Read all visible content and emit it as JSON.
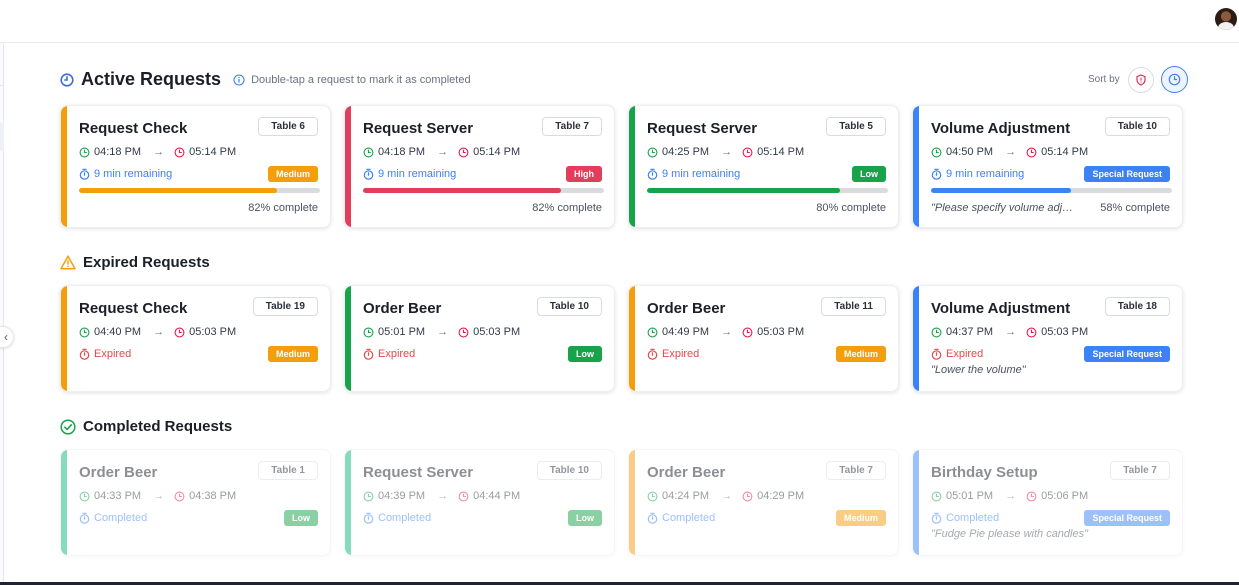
{
  "colors": {
    "orange": "#f59e0b",
    "red": "#e23d5a",
    "green": "#16a34a",
    "teal": "#10b981",
    "blue": "#3b82f6",
    "time_green": "#16a34a",
    "time_red": "#e11d48",
    "link_blue": "#3b82f6",
    "expired_red": "#e34a4a"
  },
  "header": {
    "active_title": "Active Requests",
    "active_hint": "Double-tap a request to mark it as completed",
    "sort_label": "Sort by",
    "expired_title": "Expired Requests",
    "completed_title": "Completed Requests"
  },
  "active": [
    {
      "title": "Request Check",
      "table": "Table 6",
      "start": "04:18 PM",
      "end": "05:14 PM",
      "status": "9 min remaining",
      "priority": "Medium",
      "progress": 82,
      "pct": "82% complete",
      "note": ""
    },
    {
      "title": "Request Server",
      "table": "Table 7",
      "start": "04:18 PM",
      "end": "05:14 PM",
      "status": "9 min remaining",
      "priority": "High",
      "progress": 82,
      "pct": "82% complete",
      "note": ""
    },
    {
      "title": "Request Server",
      "table": "Table 5",
      "start": "04:25 PM",
      "end": "05:14 PM",
      "status": "9 min remaining",
      "priority": "Low",
      "progress": 80,
      "pct": "80% complete",
      "note": ""
    },
    {
      "title": "Volume Adjustment",
      "table": "Table 10",
      "start": "04:50 PM",
      "end": "05:14 PM",
      "status": "9 min remaining",
      "priority": "Special Request",
      "progress": 58,
      "pct": "58% complete",
      "note": "\"Please specify volume adj…"
    }
  ],
  "expired": [
    {
      "title": "Request Check",
      "table": "Table 19",
      "start": "04:40 PM",
      "end": "05:03 PM",
      "status": "Expired",
      "priority": "Medium",
      "note": ""
    },
    {
      "title": "Order Beer",
      "table": "Table 10",
      "start": "05:01 PM",
      "end": "05:03 PM",
      "status": "Expired",
      "priority": "Low",
      "note": ""
    },
    {
      "title": "Order Beer",
      "table": "Table 11",
      "start": "04:49 PM",
      "end": "05:03 PM",
      "status": "Expired",
      "priority": "Medium",
      "note": ""
    },
    {
      "title": "Volume Adjustment",
      "table": "Table 18",
      "start": "04:37 PM",
      "end": "05:03 PM",
      "status": "Expired",
      "priority": "Special Request",
      "note": "\"Lower the volume\""
    }
  ],
  "completed": [
    {
      "title": "Order Beer",
      "table": "Table 1",
      "start": "04:33 PM",
      "end": "04:38 PM",
      "status": "Completed",
      "priority": "Low",
      "note": ""
    },
    {
      "title": "Request Server",
      "table": "Table 10",
      "start": "04:39 PM",
      "end": "04:44 PM",
      "status": "Completed",
      "priority": "Low",
      "note": ""
    },
    {
      "title": "Order Beer",
      "table": "Table 7",
      "start": "04:24 PM",
      "end": "04:29 PM",
      "status": "Completed",
      "priority": "Medium",
      "note": ""
    },
    {
      "title": "Birthday Setup",
      "table": "Table 7",
      "start": "05:01 PM",
      "end": "05:06 PM",
      "status": "Completed",
      "priority": "Special Request",
      "note": "\"Fudge Pie please with candles\""
    }
  ]
}
